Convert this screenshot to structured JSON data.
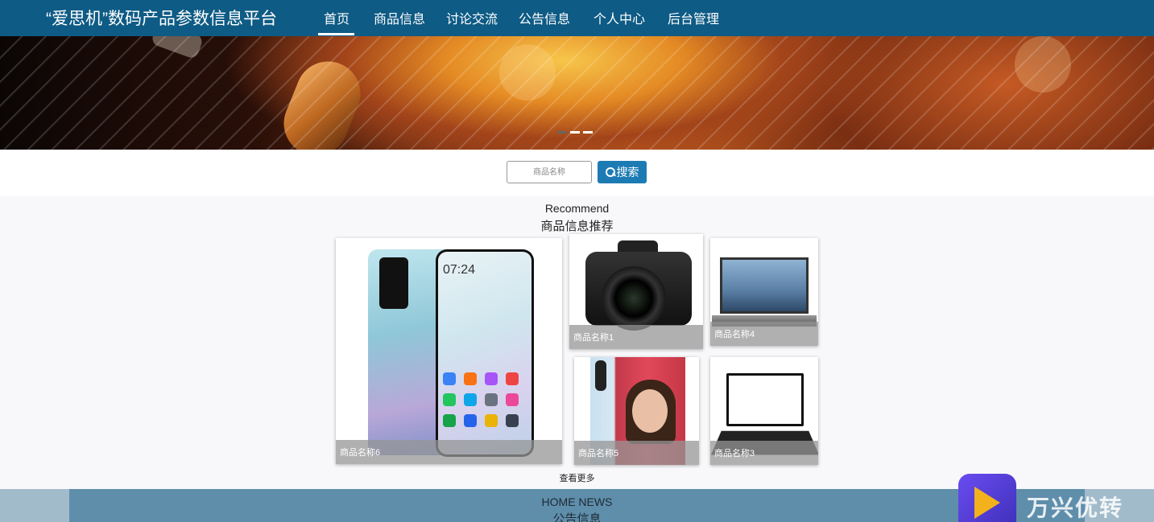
{
  "header": {
    "brand": "“爱思机”数码产品参数信息平台",
    "nav": [
      {
        "label": "首页",
        "active": true
      },
      {
        "label": "商品信息"
      },
      {
        "label": "讨论交流"
      },
      {
        "label": "公告信息"
      },
      {
        "label": "个人中心"
      },
      {
        "label": "后台管理"
      }
    ]
  },
  "banner": {
    "slides": 3,
    "active_slide": 1
  },
  "search": {
    "placeholder": "商品名称",
    "button_label": "搜索"
  },
  "recommend": {
    "title_en": "Recommend",
    "title_cn": "商品信息推荐",
    "products": [
      {
        "name": "商品名称6"
      },
      {
        "name": "商品名称1"
      },
      {
        "name": "商品名称4"
      },
      {
        "name": "商品名称5"
      },
      {
        "name": "商品名称3"
      }
    ],
    "more_label": "查看更多"
  },
  "news": {
    "title_en": "HOME NEWS",
    "title_cn": "公告信息"
  },
  "watermark": {
    "text": "万兴优转"
  },
  "colors": {
    "nav_bg": "#0e5b85",
    "button_bg": "#1d7bb4",
    "news_bg": "#5f8eab"
  }
}
